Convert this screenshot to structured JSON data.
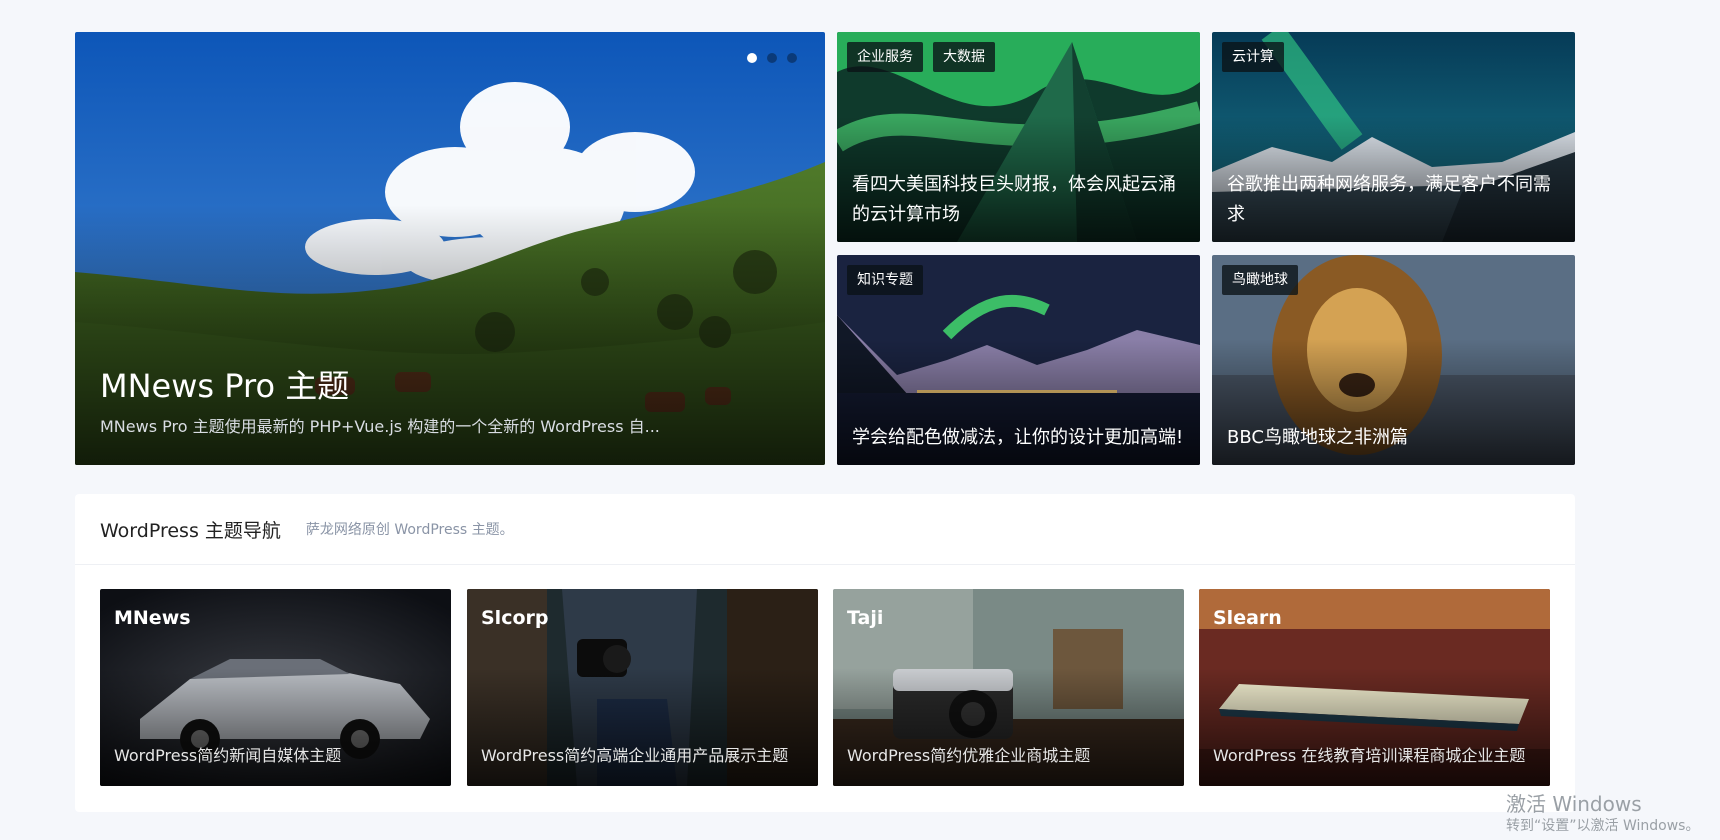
{
  "hero": {
    "title": "MNews Pro 主题",
    "description": "MNews Pro 主题使用最新的 PHP+Vue.js 构建的一个全新的 WordPress 自..."
  },
  "side_posts": [
    {
      "tags": [
        "企业服务",
        "大数据"
      ],
      "title": "看四大美国科技巨头财报，体会风起云涌的云计算市场"
    },
    {
      "tags": [
        "云计算"
      ],
      "title": "谷歌推出两种网络服务，满足客户不同需求"
    },
    {
      "tags": [
        "知识专题"
      ],
      "title": "学会给配色做减法，让你的设计更加高端!"
    },
    {
      "tags": [
        "鸟瞰地球"
      ],
      "title": "BBC鸟瞰地球之非洲篇"
    }
  ],
  "themes_section": {
    "title": "WordPress 主题导航",
    "subtitle": "萨龙网络原创 WordPress 主题。",
    "items": [
      {
        "name": "MNews",
        "desc": "WordPress简约新闻自媒体主题"
      },
      {
        "name": "Slcorp",
        "desc": "WordPress简约高端企业通用产品展示主题"
      },
      {
        "name": "Taji",
        "desc": "WordPress简约优雅企业商城主题"
      },
      {
        "name": "Slearn",
        "desc": "WordPress 在线教育培训课程商城企业主题"
      }
    ]
  },
  "watermark": {
    "line1": "激活 Windows",
    "line2": "转到“设置”以激活 Windows。"
  }
}
